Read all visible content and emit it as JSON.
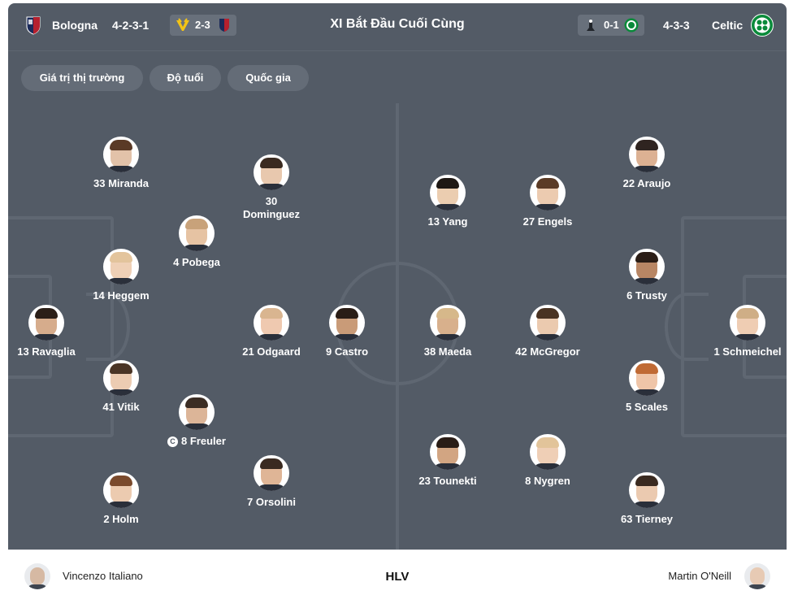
{
  "header": {
    "title": "XI Bắt Đầu Cuối Cùng",
    "home": {
      "name": "Bologna",
      "formation": "4-2-3-1",
      "last_result": "2-3",
      "crest_color": "#9b1b30",
      "crest_color_2": "#1a2a5a"
    },
    "away": {
      "name": "Celtic",
      "formation": "4-3-3",
      "last_result": "0-1",
      "crest_color": "#0a8a3a"
    }
  },
  "filters": [
    "Giá trị thị trường",
    "Độ tuổi",
    "Quốc gia"
  ],
  "home_players": [
    {
      "number": "33",
      "name": "Miranda",
      "label": "33 Miranda"
    },
    {
      "number": "30",
      "name": "Dominguez",
      "label_line1": "30",
      "label_line2": "Dominguez"
    },
    {
      "number": "4",
      "name": "Pobega",
      "label": "4 Pobega"
    },
    {
      "number": "14",
      "name": "Heggem",
      "label": "14 Heggem"
    },
    {
      "number": "13",
      "name": "Ravaglia",
      "label": "13 Ravaglia"
    },
    {
      "number": "21",
      "name": "Odgaard",
      "label": "21 Odgaard"
    },
    {
      "number": "9",
      "name": "Castro",
      "label": "9 Castro"
    },
    {
      "number": "41",
      "name": "Vitik",
      "label": "41 Vitik"
    },
    {
      "number": "8",
      "name": "Freuler",
      "label": "8 Freuler",
      "captain": "C"
    },
    {
      "number": "2",
      "name": "Holm",
      "label": "2 Holm"
    },
    {
      "number": "7",
      "name": "Orsolini",
      "label": "7 Orsolini"
    }
  ],
  "away_players": [
    {
      "number": "22",
      "name": "Araujo",
      "label": "22 Araujo"
    },
    {
      "number": "13",
      "name": "Yang",
      "label": "13 Yang"
    },
    {
      "number": "27",
      "name": "Engels",
      "label": "27 Engels"
    },
    {
      "number": "6",
      "name": "Trusty",
      "label": "6 Trusty"
    },
    {
      "number": "38",
      "name": "Maeda",
      "label": "38 Maeda"
    },
    {
      "number": "42",
      "name": "McGregor",
      "label": "42 McGregor"
    },
    {
      "number": "1",
      "name": "Schmeichel",
      "label": "1 Schmeichel"
    },
    {
      "number": "5",
      "name": "Scales",
      "label": "5 Scales"
    },
    {
      "number": "23",
      "name": "Tounekti",
      "label": "23 Tounekti"
    },
    {
      "number": "8",
      "name": "Nygren",
      "label": "8 Nygren"
    },
    {
      "number": "63",
      "name": "Tierney",
      "label": "63 Tierney"
    }
  ],
  "coaches": {
    "label": "HLV",
    "home": "Vincenzo Italiano",
    "away": "Martin O'Neill"
  },
  "colors": {
    "pitch": "#535b66",
    "pitch_lines": "#5f6772",
    "pill": "#646c77"
  }
}
